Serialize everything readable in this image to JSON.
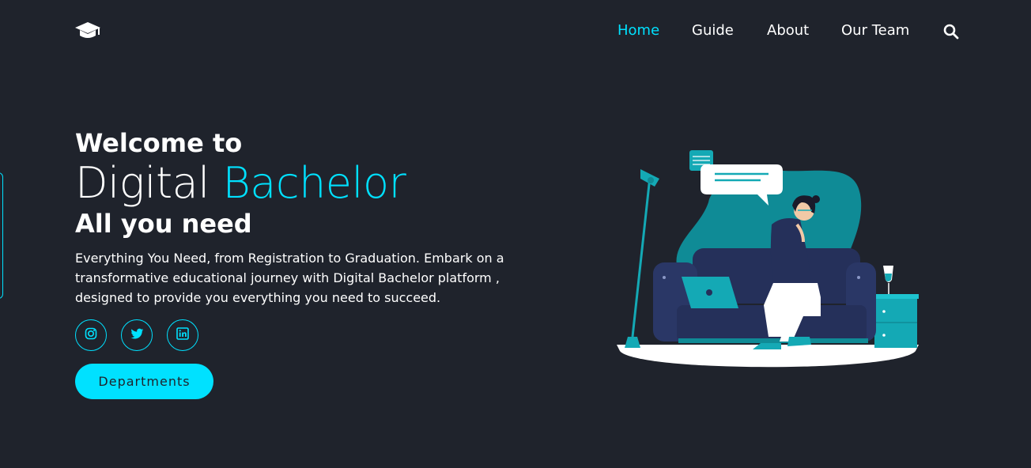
{
  "brand": {
    "logo_icon": "graduation-cap-icon"
  },
  "nav": {
    "items": [
      {
        "label": "Home",
        "active": true
      },
      {
        "label": "Guide",
        "active": false
      },
      {
        "label": "About",
        "active": false
      },
      {
        "label": "Our Team",
        "active": false
      }
    ],
    "search_icon": "search-icon"
  },
  "hero": {
    "welcome": "Welcome to",
    "title_plain": "Digital",
    "title_accent": "Bachelor",
    "subtitle": "All you need",
    "description": "Everything You Need, from Registration to Graduation. Embark on a transformative educational journey with Digital Bachelor platform , designed to provide you everything you need to succeed.",
    "social": [
      "instagram-icon",
      "twitter-icon",
      "linkedin-icon"
    ],
    "cta_label": "Departments"
  },
  "colors": {
    "background": "#1f232c",
    "accent": "#00e1ff",
    "illustration_teal": "#0f8b96",
    "sofa_navy": "#25305a"
  }
}
